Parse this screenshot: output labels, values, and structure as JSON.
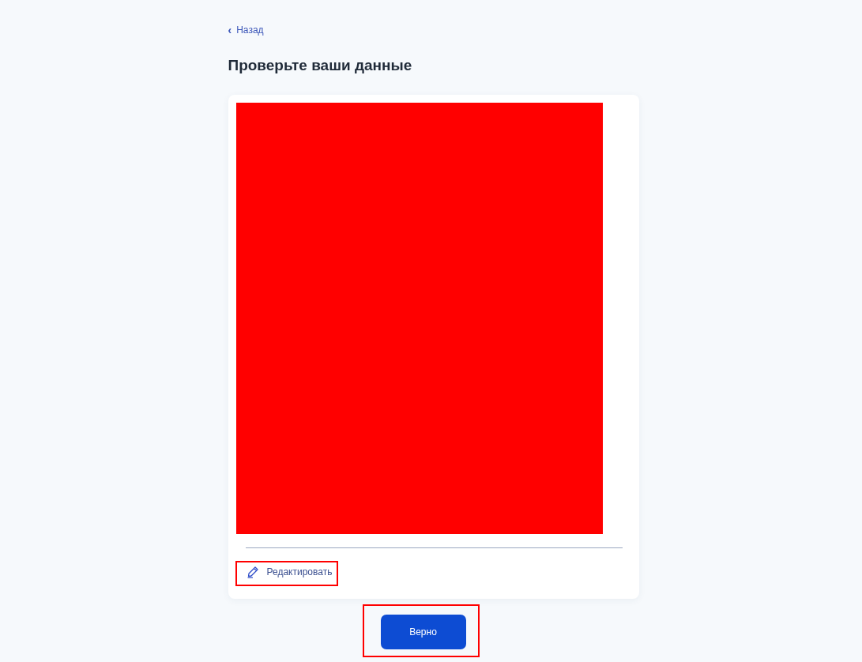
{
  "back_link": {
    "icon": "‹",
    "label": "Назад"
  },
  "title": "Проверьте ваши данные",
  "card": {
    "redacted": true,
    "edit_link": {
      "label": "Редактировать",
      "highlighted": true
    }
  },
  "confirm_button": {
    "label": "Верно",
    "highlighted": true
  }
}
